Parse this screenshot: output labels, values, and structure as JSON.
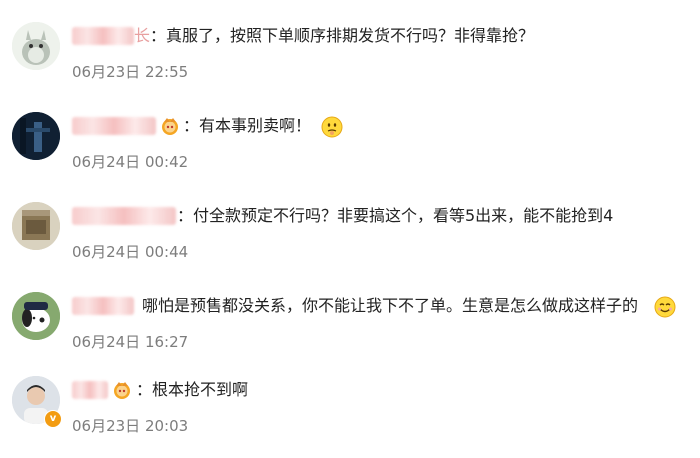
{
  "comments": [
    {
      "name_visible_tail": "长",
      "text": "：真服了，按照下单顺序排期发货不行吗？非得靠抢？",
      "time": "06月23日 22:55"
    },
    {
      "text": "：有本事别卖啊！",
      "emoji": "thinking-face-emoji",
      "time": "06月24日 00:42"
    },
    {
      "text": "：付全款预定不行吗？非要搞这个，看等5出来，能不能抢到4",
      "time": "06月24日 00:44"
    },
    {
      "text": "哪怕是预售都没关系，你不能让我下不了单。生意是怎么做成这样子的",
      "emoji": "smile-emoji",
      "time": "06月24日 16:27"
    },
    {
      "text": "：根本抢不到啊",
      "time": "06月23日 20:03",
      "badge": "v"
    }
  ],
  "colors": {
    "text": "#222222",
    "time": "#7d7d7d",
    "vip": "#f5a623",
    "badge": "#f39c12"
  }
}
